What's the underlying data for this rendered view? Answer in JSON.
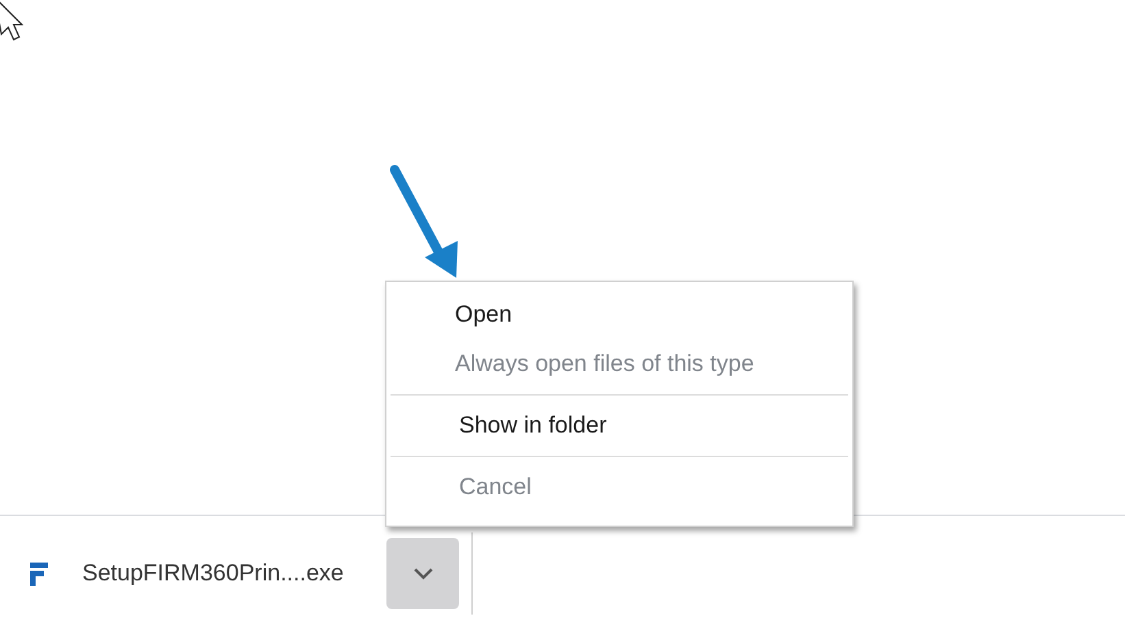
{
  "context_menu": {
    "groups": [
      [
        {
          "label": "Open",
          "disabled": false
        },
        {
          "label": "Always open files of this type",
          "disabled": true
        }
      ],
      [
        {
          "label": "Show in folder",
          "disabled": false
        }
      ],
      [
        {
          "label": "Cancel",
          "disabled": true
        }
      ]
    ]
  },
  "download_shelf": {
    "file_name": "SetupFIRM360Prin....exe"
  }
}
